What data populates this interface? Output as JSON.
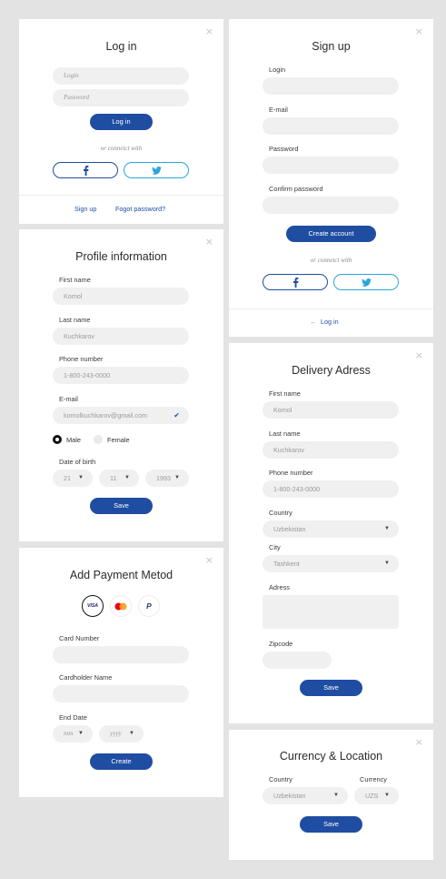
{
  "close_glyph": "×",
  "login": {
    "title": "Log in",
    "login_placeholder": "Login",
    "password_placeholder": "Password",
    "submit": "Log in",
    "or_text": "or connetct with",
    "signup_link": "Sign up",
    "forgot_link": "Fogot password?"
  },
  "signup": {
    "title": "Sign up",
    "login_label": "Login",
    "email_label": "E-mail",
    "password_label": "Password",
    "confirm_label": "Confirm password",
    "submit": "Create account",
    "or_text": "or connetct with",
    "login_link": "Log in",
    "back_arrow": "←"
  },
  "profile": {
    "title": "Profile information",
    "first_name_label": "First name",
    "first_name_value": "Komol",
    "last_name_label": "Last name",
    "last_name_value": "Kuchkarov",
    "phone_label": "Phone number",
    "phone_value": "1-800-243-0000",
    "email_label": "E-mail",
    "email_value": "komolkuchkarov@gmail.com",
    "gender_options": [
      "Male",
      "Female"
    ],
    "gender_selected": "Male",
    "dob_label": "Date of birth",
    "dob_day": "21",
    "dob_month": "11",
    "dob_year": "1993",
    "submit": "Save"
  },
  "delivery": {
    "title": "Delivery Adress",
    "first_name_label": "First name",
    "first_name_value": "Komol",
    "last_name_label": "Last name",
    "last_name_value": "Kuchkarov",
    "phone_label": "Phone number",
    "phone_value": "1-800-243-0000",
    "country_label": "Country",
    "country_value": "Uzbekistan",
    "city_label": "City",
    "city_value": "Tashkent",
    "address_label": "Adress",
    "zipcode_label": "Zipcode",
    "submit": "Save"
  },
  "payment": {
    "title": "Add Payment Metod",
    "methods": [
      "visa",
      "mastercard",
      "paypal"
    ],
    "selected_method": "visa",
    "visa_text": "VISA",
    "paypal_text": "P",
    "card_number_label": "Card Number",
    "cardholder_label": "Cardholder Name",
    "end_date_label": "End Date",
    "mm_placeholder": "mm",
    "yyyy_placeholder": "yyyy",
    "submit": "Create"
  },
  "currency": {
    "title": "Currency & Location",
    "country_label": "Country",
    "country_value": "Uzbekistan",
    "currency_label": "Currency",
    "currency_value": "UZS",
    "submit": "Save"
  },
  "icons": {
    "facebook": "f",
    "chevron": "▼",
    "check": "✔"
  },
  "colors": {
    "primary": "#1f4da1",
    "twitter": "#29a6dc",
    "background": "#e3e3e3"
  }
}
